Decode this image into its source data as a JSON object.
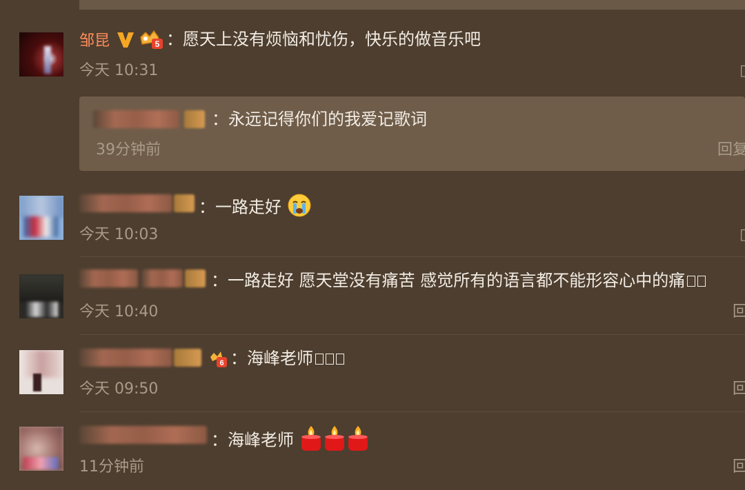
{
  "comments": [
    {
      "name": "邹昆",
      "text": "：愿天上没有烦恼和忧伤，快乐的做音乐吧",
      "time": "今天 10:31",
      "reply": {
        "text": "：永远记得你们的我爱记歌词",
        "time": "39分钟前",
        "action": "回复"
      }
    },
    {
      "text": "：一路走好",
      "time": "今天 10:03"
    },
    {
      "text": "：一路走好 愿天堂没有痛苦 感觉所有的语言都不能形容心中的痛",
      "time": "今天 10:40",
      "action": "回"
    },
    {
      "text": "：海峰老师",
      "time": "今天 09:50",
      "action": "回"
    },
    {
      "text": "：海峰老师",
      "time": "11分钟前",
      "action": "回"
    }
  ],
  "colors": {
    "background": "#4d3e2f",
    "reply_box": "#6f5d4a",
    "username": "#ff8c5a",
    "comment_text": "#f2ece4",
    "timestamp": "#a99b8a",
    "verified_v": "#f5a623"
  },
  "icons": [
    "verified-v-icon",
    "vip-crown-icon",
    "crying-face-emoji",
    "candle-emoji"
  ]
}
